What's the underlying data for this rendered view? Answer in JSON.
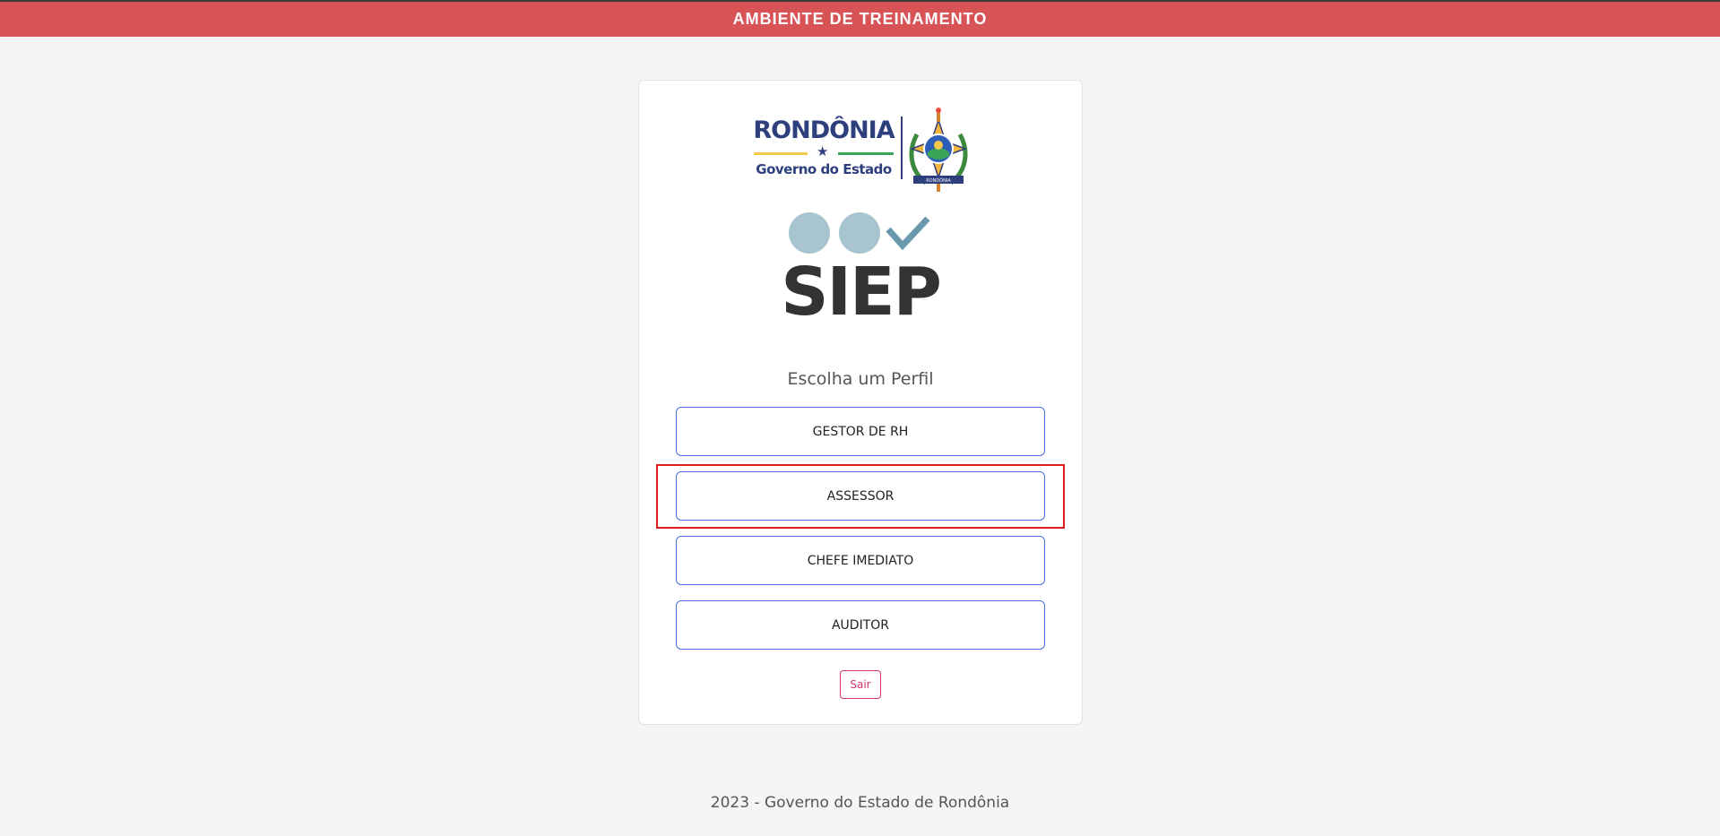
{
  "banner": {
    "text": "AMBIENTE DE TREINAMENTO",
    "color": "#d75356"
  },
  "government": {
    "name": "RONDÔNIA",
    "subtitle": "Governo do Estado",
    "coat_of_arms": {
      "icon": "coat-of-arms-icon",
      "text": "RONDÔNIA"
    }
  },
  "app": {
    "name": "SIEP",
    "marks": [
      "circle-icon",
      "circle-icon",
      "check-icon"
    ]
  },
  "profile_selection": {
    "heading": "Escolha um Perfil",
    "options": [
      {
        "label": "GESTOR DE RH"
      },
      {
        "label": "ASSESSOR",
        "highlighted": true
      },
      {
        "label": "CHEFE IMEDIATO"
      },
      {
        "label": "AUDITOR"
      }
    ],
    "logout_label": "Sair"
  },
  "footer": {
    "text": "2023 - Governo do Estado de Rondônia"
  },
  "colors": {
    "button_border": "#4a6cdc",
    "logout": "#d6336c",
    "highlight": "#e01b1b",
    "mark_circles": "#a9c4d1",
    "mark_check": "#6a99ad"
  }
}
